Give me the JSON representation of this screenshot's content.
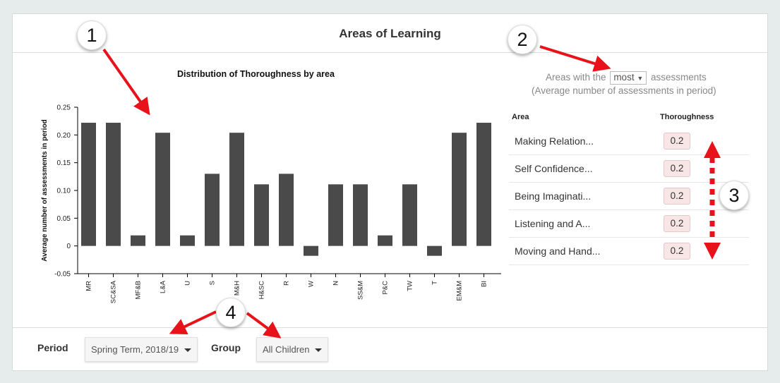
{
  "header": {
    "title": "Areas of Learning"
  },
  "chart_data": {
    "type": "bar",
    "title": "Distribution of Thoroughness by area",
    "ylabel": "Average number of assessments in period",
    "xlabel": "",
    "ylim": [
      -0.05,
      0.25
    ],
    "yticks": [
      "0.25",
      "0.20",
      "0.15",
      "0.10",
      "0.05",
      "0",
      "-0.05"
    ],
    "categories": [
      "MR",
      "SC&SA",
      "MF&B",
      "L&A",
      "U",
      "S",
      "M&H",
      "H&SC",
      "R",
      "W",
      "N",
      "SS&M",
      "P&C",
      "TW",
      "T",
      "EM&M",
      "BI"
    ],
    "values": [
      0.222,
      0.222,
      0.019,
      0.204,
      0.019,
      0.13,
      0.204,
      0.111,
      0.13,
      0.0,
      0.111,
      0.111,
      0.019,
      0.111,
      0.0,
      0.204,
      0.222
    ],
    "bar_color": "#4a4a4a"
  },
  "selector": {
    "prefix": "Areas with the",
    "value": "most",
    "suffix": "assessments",
    "subtitle": "(Average number of assessments in period)"
  },
  "table": {
    "headers": {
      "area": "Area",
      "thoroughness": "Thoroughness"
    },
    "rows": [
      {
        "name": "Making Relation...",
        "value": "0.2"
      },
      {
        "name": "Self Confidence...",
        "value": "0.2"
      },
      {
        "name": "Being Imaginati...",
        "value": "0.2"
      },
      {
        "name": "Listening and A...",
        "value": "0.2"
      },
      {
        "name": "Moving and Hand...",
        "value": "0.2"
      }
    ]
  },
  "footer": {
    "period_label": "Period",
    "period_value": "Spring Term, 2018/19",
    "group_label": "Group",
    "group_value": "All Children"
  },
  "callouts": [
    "1",
    "2",
    "3",
    "4"
  ],
  "colors": {
    "arrow": "#e8121a",
    "value_badge_bg": "#f8e6e6"
  }
}
